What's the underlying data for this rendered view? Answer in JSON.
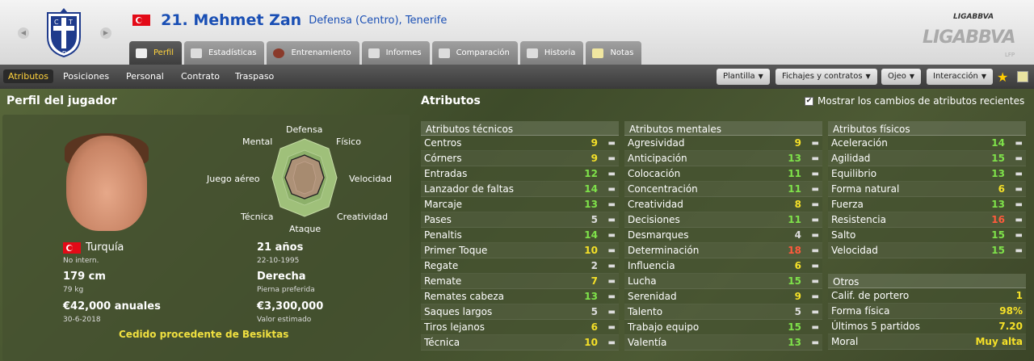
{
  "header": {
    "number_name": "21. Mehmet Zan",
    "position_club": "Defensa (Centro), Tenerife",
    "tabs": [
      {
        "label": "Perfil",
        "active": true
      },
      {
        "label": "Estadísticas"
      },
      {
        "label": "Entrenamiento"
      },
      {
        "label": "Informes"
      },
      {
        "label": "Comparación"
      },
      {
        "label": "Historia"
      },
      {
        "label": "Notas"
      }
    ],
    "logo_top": "LIGABBVA",
    "logo_main": "LIGABBVA",
    "logo_small": "LFP"
  },
  "subnav": {
    "items": [
      "Atributos",
      "Posiciones",
      "Personal",
      "Contrato",
      "Traspaso"
    ],
    "buttons": [
      "Plantilla",
      "Fichajes y contratos",
      "Ojeo",
      "Interacción"
    ]
  },
  "profile": {
    "title": "Perfil del jugador",
    "radar": {
      "labels": [
        "Defensa",
        "Físico",
        "Velocidad",
        "Creatividad",
        "Ataque",
        "Técnica",
        "Juego aéreo",
        "Mental"
      ]
    },
    "nationality": "Turquía",
    "intl": "No intern.",
    "age": "21 años",
    "dob": "22-10-1995",
    "height": "179 cm",
    "weight": "79 kg",
    "foot": "Derecha",
    "foot_label": "Pierna preferida",
    "wage": "€42,000 anuales",
    "contract_end": "30-6-2018",
    "value": "€3,300,000",
    "value_label": "Valor estimado",
    "loan": "Cedido procedente de Besiktas"
  },
  "attributes": {
    "title": "Atributos",
    "show_changes": "Mostrar los cambios de atributos recientes",
    "tecnicos_title": "Atributos técnicos",
    "tecnicos": [
      {
        "n": "Centros",
        "v": "9",
        "c": "#f5e028",
        "t": "▬"
      },
      {
        "n": "Córners",
        "v": "9",
        "c": "#f5e028",
        "t": "▬"
      },
      {
        "n": "Entradas",
        "v": "12",
        "c": "#7fe24a",
        "t": "▬"
      },
      {
        "n": "Lanzador de faltas",
        "v": "14",
        "c": "#7fe24a",
        "t": "▬"
      },
      {
        "n": "Marcaje",
        "v": "13",
        "c": "#7fe24a",
        "t": "▬"
      },
      {
        "n": "Pases",
        "v": "5",
        "c": "#dddddd",
        "t": "▬"
      },
      {
        "n": "Penaltis",
        "v": "14",
        "c": "#7fe24a",
        "t": "▬"
      },
      {
        "n": "Primer Toque",
        "v": "10",
        "c": "#f5e028",
        "t": "▬"
      },
      {
        "n": "Regate",
        "v": "2",
        "c": "#dddddd",
        "t": "▬"
      },
      {
        "n": "Remate",
        "v": "7",
        "c": "#f5e028",
        "t": "▬"
      },
      {
        "n": "Remates cabeza",
        "v": "13",
        "c": "#7fe24a",
        "t": "▬"
      },
      {
        "n": "Saques largos",
        "v": "5",
        "c": "#dddddd",
        "t": "▬"
      },
      {
        "n": "Tiros lejanos",
        "v": "6",
        "c": "#f5e028",
        "t": "▬"
      },
      {
        "n": "Técnica",
        "v": "10",
        "c": "#f5e028",
        "t": "▬"
      }
    ],
    "mentales_title": "Atributos mentales",
    "mentales": [
      {
        "n": "Agresividad",
        "v": "9",
        "c": "#f5e028",
        "t": "▬"
      },
      {
        "n": "Anticipación",
        "v": "13",
        "c": "#7fe24a",
        "t": "▬"
      },
      {
        "n": "Colocación",
        "v": "11",
        "c": "#7fe24a",
        "t": "▬"
      },
      {
        "n": "Concentración",
        "v": "11",
        "c": "#7fe24a",
        "t": "▬"
      },
      {
        "n": "Creatividad",
        "v": "8",
        "c": "#f5e028",
        "t": "▬"
      },
      {
        "n": "Decisiones",
        "v": "11",
        "c": "#7fe24a",
        "t": "▬"
      },
      {
        "n": "Desmarques",
        "v": "4",
        "c": "#dddddd",
        "t": "▬"
      },
      {
        "n": "Determinación",
        "v": "18",
        "c": "#ff5a3c",
        "t": "▬"
      },
      {
        "n": "Influencia",
        "v": "6",
        "c": "#f5e028",
        "t": "▬"
      },
      {
        "n": "Lucha",
        "v": "15",
        "c": "#7fe24a",
        "t": "▬"
      },
      {
        "n": "Serenidad",
        "v": "9",
        "c": "#f5e028",
        "t": "▬"
      },
      {
        "n": "Talento",
        "v": "5",
        "c": "#dddddd",
        "t": "▬"
      },
      {
        "n": "Trabajo equipo",
        "v": "15",
        "c": "#7fe24a",
        "t": "▬"
      },
      {
        "n": "Valentía",
        "v": "13",
        "c": "#7fe24a",
        "t": "▬"
      }
    ],
    "fisicos_title": "Atributos físicos",
    "fisicos": [
      {
        "n": "Aceleración",
        "v": "14",
        "c": "#7fe24a",
        "t": "▬"
      },
      {
        "n": "Agilidad",
        "v": "15",
        "c": "#7fe24a",
        "t": "▬"
      },
      {
        "n": "Equilibrio",
        "v": "13",
        "c": "#7fe24a",
        "t": "▬"
      },
      {
        "n": "Forma natural",
        "v": "6",
        "c": "#f5e028",
        "t": "▬"
      },
      {
        "n": "Fuerza",
        "v": "13",
        "c": "#7fe24a",
        "t": "▬"
      },
      {
        "n": "Resistencia",
        "v": "16",
        "c": "#ff5a3c",
        "t": "▬"
      },
      {
        "n": "Salto",
        "v": "15",
        "c": "#7fe24a",
        "t": "▬"
      },
      {
        "n": "Velocidad",
        "v": "15",
        "c": "#7fe24a",
        "t": "▬"
      }
    ],
    "otros_title": "Otros",
    "otros": [
      {
        "n": "Calif. de portero",
        "v": "1",
        "c": "#f5e028"
      },
      {
        "n": "Forma física",
        "v": "98%",
        "c": "#f5e028"
      },
      {
        "n": "Últimos 5 partidos",
        "v": "7.20",
        "c": "#f5e028"
      },
      {
        "n": "Moral",
        "v": "Muy alta",
        "c": "#f5e028"
      }
    ]
  }
}
